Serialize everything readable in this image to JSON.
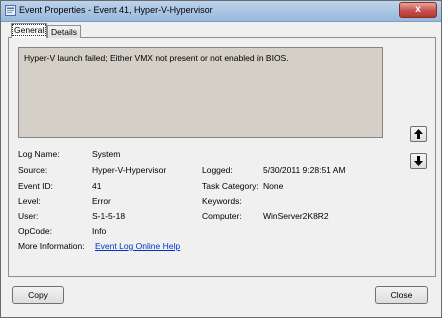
{
  "window": {
    "title": "Event Properties - Event 41, Hyper-V-Hypervisor",
    "close_glyph": "x"
  },
  "tabs": {
    "general": "General",
    "details": "Details"
  },
  "description": "Hyper-V launch failed; Either VMX not present or not enabled in BIOS.",
  "fields": {
    "log_name": {
      "label": "Log Name:",
      "value": "System"
    },
    "source": {
      "label": "Source:",
      "value": "Hyper-V-Hypervisor"
    },
    "event_id": {
      "label": "Event ID:",
      "value": "41"
    },
    "level": {
      "label": "Level:",
      "value": "Error"
    },
    "user": {
      "label": "User:",
      "value": "S-1-5-18"
    },
    "opcode": {
      "label": "OpCode:",
      "value": "Info"
    },
    "more_info": {
      "label": "More Information:",
      "value": "Event Log Online Help"
    },
    "logged": {
      "label": "Logged:",
      "value": "5/30/2011 9:28:51 AM"
    },
    "task_category": {
      "label": "Task Category:",
      "value": "None"
    },
    "keywords": {
      "label": "Keywords:",
      "value": ""
    },
    "computer": {
      "label": "Computer:",
      "value": "WinServer2K8R2"
    }
  },
  "buttons": {
    "copy": "Copy",
    "close": "Close"
  },
  "icons": {
    "previous": "arrow-up-icon",
    "next": "arrow-down-icon",
    "window": "event-viewer-icon"
  },
  "colors": {
    "titlebar": "#9ab8dc",
    "link": "#0033cc",
    "description_background": "#d4d0c8",
    "dialog": "#f0f0f0",
    "close_button": "#c75050"
  }
}
